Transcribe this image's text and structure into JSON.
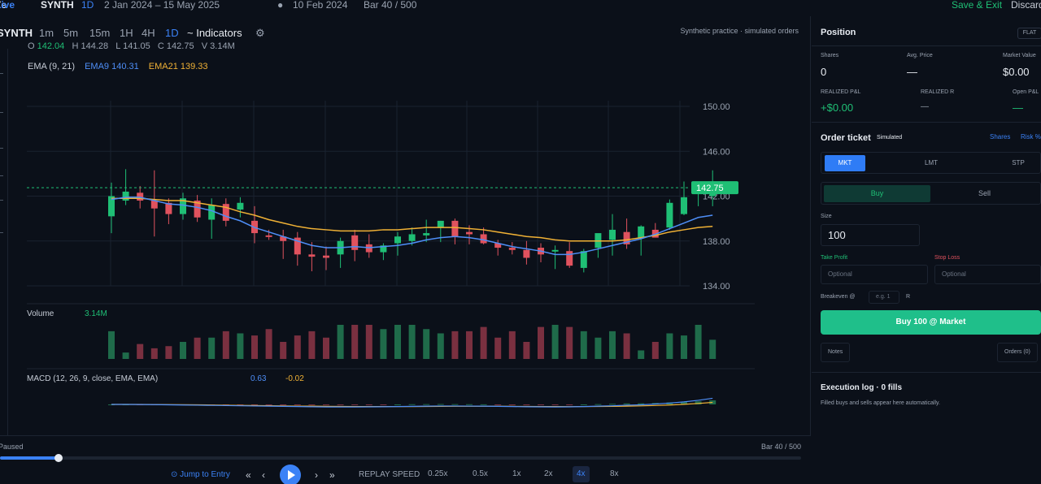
{
  "topbar": {
    "brand_prefix": "Ze",
    "brand_suffix": "Live",
    "symbol": "SYNTH",
    "timeframe": "1D",
    "range": "2 Jan 2024 – 15 May 2025",
    "dot": "●",
    "current_date": "10 Feb 2024",
    "bar_counter": "Bar 40 / 500",
    "save_exit": "Save & Exit",
    "discard": "Discard"
  },
  "toolbar": {
    "symbol": "SYNTH",
    "timeframes": [
      "1m",
      "5m",
      "15m",
      "1H",
      "4H",
      "1D"
    ],
    "active_timeframe": "1D",
    "indicators": "~ Indicators",
    "gear": "⚙",
    "note": "Synthetic practice · simulated orders"
  },
  "legend": {
    "o_label": "O",
    "o_val": "142.04",
    "h_label": "H",
    "h_val": "144.28",
    "l_label": "L",
    "l_val": "141.05",
    "c_label": "C",
    "c_val": "142.75",
    "v_label": "V",
    "v_val": "3.14M",
    "ema_label": "EMA (9, 21)",
    "ema9": "EMA9 140.31",
    "ema21": "EMA21 139.33"
  },
  "volume": {
    "label": "Volume",
    "value": "3.14M"
  },
  "macd": {
    "label": "MACD (12, 26, 9, close, EMA, EMA)",
    "v1": "0.63",
    "v2": "-0.02"
  },
  "chart_data": {
    "type": "candlestick",
    "price_axis_ticks": [
      "150.00",
      "146.00",
      "142.00",
      "138.00",
      "134.00"
    ],
    "ylim": [
      133,
      151
    ],
    "last_price": "142.75",
    "candles": [
      {
        "o": 140.2,
        "h": 143.2,
        "l": 138.7,
        "c": 142.0
      },
      {
        "o": 141.6,
        "h": 144.4,
        "l": 141.2,
        "c": 142.4
      },
      {
        "o": 142.3,
        "h": 142.9,
        "l": 140.9,
        "c": 141.6
      },
      {
        "o": 141.6,
        "h": 144.3,
        "l": 138.4,
        "c": 140.9
      },
      {
        "o": 141.4,
        "h": 141.8,
        "l": 139.5,
        "c": 140.4
      },
      {
        "o": 140.4,
        "h": 142.3,
        "l": 139.9,
        "c": 141.8
      },
      {
        "o": 141.6,
        "h": 142.1,
        "l": 139.7,
        "c": 140.1
      },
      {
        "o": 139.9,
        "h": 141.8,
        "l": 138.2,
        "c": 141.2
      },
      {
        "o": 141.3,
        "h": 141.8,
        "l": 139.3,
        "c": 139.8
      },
      {
        "o": 140.8,
        "h": 141.9,
        "l": 140.1,
        "c": 141.4
      },
      {
        "o": 139.8,
        "h": 141.1,
        "l": 137.8,
        "c": 138.7
      },
      {
        "o": 138.5,
        "h": 139.0,
        "l": 138.1,
        "c": 138.4
      },
      {
        "o": 138.4,
        "h": 139.0,
        "l": 136.4,
        "c": 138.0
      },
      {
        "o": 138.3,
        "h": 138.8,
        "l": 135.8,
        "c": 136.8
      },
      {
        "o": 136.8,
        "h": 137.9,
        "l": 135.3,
        "c": 136.6
      },
      {
        "o": 136.7,
        "h": 137.5,
        "l": 135.4,
        "c": 136.5
      },
      {
        "o": 136.8,
        "h": 138.3,
        "l": 135.6,
        "c": 138.0
      },
      {
        "o": 138.5,
        "h": 139.0,
        "l": 136.2,
        "c": 137.2
      },
      {
        "o": 137.7,
        "h": 138.6,
        "l": 136.5,
        "c": 137.0
      },
      {
        "o": 137.0,
        "h": 137.8,
        "l": 136.3,
        "c": 137.6
      },
      {
        "o": 137.8,
        "h": 138.8,
        "l": 136.7,
        "c": 138.4
      },
      {
        "o": 138.0,
        "h": 139.2,
        "l": 137.6,
        "c": 138.6
      },
      {
        "o": 138.5,
        "h": 139.9,
        "l": 137.9,
        "c": 138.7
      },
      {
        "o": 139.2,
        "h": 139.8,
        "l": 137.9,
        "c": 139.8
      },
      {
        "o": 139.8,
        "h": 140.0,
        "l": 137.7,
        "c": 138.4
      },
      {
        "o": 138.8,
        "h": 139.4,
        "l": 137.7,
        "c": 138.6
      },
      {
        "o": 138.6,
        "h": 139.2,
        "l": 137.7,
        "c": 137.8
      },
      {
        "o": 137.8,
        "h": 138.1,
        "l": 136.7,
        "c": 137.4
      },
      {
        "o": 137.4,
        "h": 137.9,
        "l": 136.8,
        "c": 137.2
      },
      {
        "o": 137.2,
        "h": 138.0,
        "l": 135.9,
        "c": 136.5
      },
      {
        "o": 137.4,
        "h": 137.8,
        "l": 136.1,
        "c": 136.8
      },
      {
        "o": 137.1,
        "h": 137.6,
        "l": 135.5,
        "c": 137.2
      },
      {
        "o": 137.1,
        "h": 137.9,
        "l": 135.6,
        "c": 135.8
      },
      {
        "o": 135.6,
        "h": 137.3,
        "l": 135.2,
        "c": 137.1
      },
      {
        "o": 137.4,
        "h": 138.6,
        "l": 136.5,
        "c": 138.7
      },
      {
        "o": 138.1,
        "h": 140.4,
        "l": 136.7,
        "c": 139.0
      },
      {
        "o": 138.8,
        "h": 140.0,
        "l": 137.3,
        "c": 137.7
      },
      {
        "o": 138.3,
        "h": 139.4,
        "l": 136.7,
        "c": 139.3
      },
      {
        "o": 139.0,
        "h": 139.6,
        "l": 138.6,
        "c": 138.3
      },
      {
        "o": 139.2,
        "h": 141.7,
        "l": 139.0,
        "c": 141.4
      },
      {
        "o": 140.4,
        "h": 143.3,
        "l": 140.3,
        "c": 141.9
      },
      {
        "o": 142.5,
        "h": 143.0,
        "l": 141.1,
        "c": 143.3
      },
      {
        "o": 142.0,
        "h": 144.3,
        "l": 141.1,
        "c": 142.8
      }
    ],
    "ema9": [
      141.7,
      141.9,
      141.9,
      141.6,
      141.3,
      141.2,
      141.0,
      140.7,
      140.2,
      139.8,
      139.2,
      138.8,
      138.4,
      138.0,
      137.6,
      137.4,
      137.4,
      137.5,
      137.4,
      137.5,
      137.6,
      137.8,
      138.1,
      138.3,
      138.4,
      138.3,
      138.1,
      137.8,
      137.5,
      137.3,
      137.1,
      136.8,
      136.8,
      137.0,
      137.3,
      137.6,
      137.9,
      138.2,
      138.6,
      139.1,
      139.6,
      140.1,
      140.3
    ],
    "ema21": [
      141.8,
      141.8,
      141.8,
      141.7,
      141.6,
      141.6,
      141.4,
      141.2,
      141.0,
      140.6,
      140.3,
      139.9,
      139.6,
      139.3,
      139.1,
      139.0,
      138.9,
      138.9,
      138.9,
      139.0,
      139.0,
      139.1,
      139.2,
      139.2,
      139.2,
      139.1,
      139.0,
      138.8,
      138.6,
      138.4,
      138.3,
      138.1,
      138.0,
      138.0,
      138.0,
      138.0,
      138.1,
      138.3,
      138.5,
      138.8,
      139.0,
      139.2,
      139.3
    ],
    "volume": [
      1.3,
      0.3,
      0.7,
      0.5,
      0.6,
      0.8,
      1.0,
      1.0,
      1.3,
      1.2,
      1.1,
      1.4,
      0.8,
      1.1,
      1.3,
      1.0,
      1.6,
      1.6,
      1.6,
      1.4,
      1.6,
      1.6,
      1.4,
      1.2,
      1.3,
      1.3,
      1.5,
      1.0,
      1.3,
      0.8,
      1.5,
      1.6,
      1.5,
      1.3,
      1.0,
      1.3,
      1.2,
      0.4,
      0.8,
      1.2,
      1.1,
      1.6,
      0.9
    ],
    "volume_max": 1.6,
    "macd_line": [
      0.0,
      0.0,
      -0.01,
      -0.02,
      -0.04,
      -0.06,
      -0.08,
      -0.1,
      -0.12,
      -0.14,
      -0.16,
      -0.18,
      -0.2,
      -0.22,
      -0.24,
      -0.26,
      -0.26,
      -0.26,
      -0.25,
      -0.24,
      -0.22,
      -0.2,
      -0.18,
      -0.16,
      -0.16,
      -0.17,
      -0.18,
      -0.2,
      -0.22,
      -0.24,
      -0.25,
      -0.26,
      -0.25,
      -0.22,
      -0.18,
      -0.14,
      -0.08,
      -0.04,
      0.04,
      0.14,
      0.26,
      0.42,
      0.63
    ],
    "signal_line": [
      0.0,
      0.0,
      0.0,
      -0.01,
      -0.02,
      -0.03,
      -0.04,
      -0.06,
      -0.08,
      -0.1,
      -0.11,
      -0.13,
      -0.15,
      -0.17,
      -0.18,
      -0.2,
      -0.21,
      -0.22,
      -0.22,
      -0.22,
      -0.22,
      -0.22,
      -0.21,
      -0.2,
      -0.19,
      -0.19,
      -0.19,
      -0.19,
      -0.2,
      -0.21,
      -0.22,
      -0.22,
      -0.23,
      -0.22,
      -0.21,
      -0.2,
      -0.18,
      -0.15,
      -0.11,
      -0.06,
      0.01,
      0.1,
      0.21
    ]
  },
  "replay": {
    "status": "Paused",
    "bar": "Bar 40 / 500",
    "progress": 0.073,
    "jump": "⊙ Jump to Entry",
    "first": "«",
    "prev": "‹",
    "next": "›",
    "last": "»",
    "speed_label": "REPLAY SPEED",
    "speeds": [
      "0.25x",
      "0.5x",
      "1x",
      "2x",
      "4x",
      "8x"
    ],
    "active_speed": "4x"
  },
  "position": {
    "title": "Position",
    "badge": "FLAT",
    "shares_label": "Shares",
    "shares": "0",
    "avg_label": "Avg. Price",
    "avg": "—",
    "mv_label": "Market Value",
    "mv": "$0.00",
    "rpl_label": "REALIZED P&L",
    "rpl": "+$0.00",
    "rr_label": "REALIZED R",
    "rr": "—",
    "opl_label": "Open P&L",
    "opl": "—"
  },
  "ticket": {
    "title": "Order ticket",
    "simulated": "Simulated",
    "shares_link": "Shares",
    "risk_link": "Risk %",
    "types": [
      "MKT",
      "LMT",
      "STP"
    ],
    "buy": "Buy",
    "sell": "Sell",
    "size_label": "Size",
    "size": "100",
    "tp_label": "Take Profit",
    "sl_label": "Stop Loss",
    "tp_placeholder": "Optional",
    "sl_placeholder": "Optional",
    "be_label": "Breakeven @",
    "be_placeholder": "e.g. 1",
    "be_unit": "R",
    "submit": "Buy 100 @ Market",
    "notes": "Notes",
    "orders": "Orders (0)"
  },
  "log": {
    "title": "Execution log · 0 fills",
    "subtitle": "Filled buys and sells appear here automatically."
  },
  "colors": {
    "up": "#1fbf75",
    "down": "#e0525e",
    "ema9": "#4e8ef7",
    "ema21": "#f0b135",
    "accent": "#3b82f6"
  }
}
